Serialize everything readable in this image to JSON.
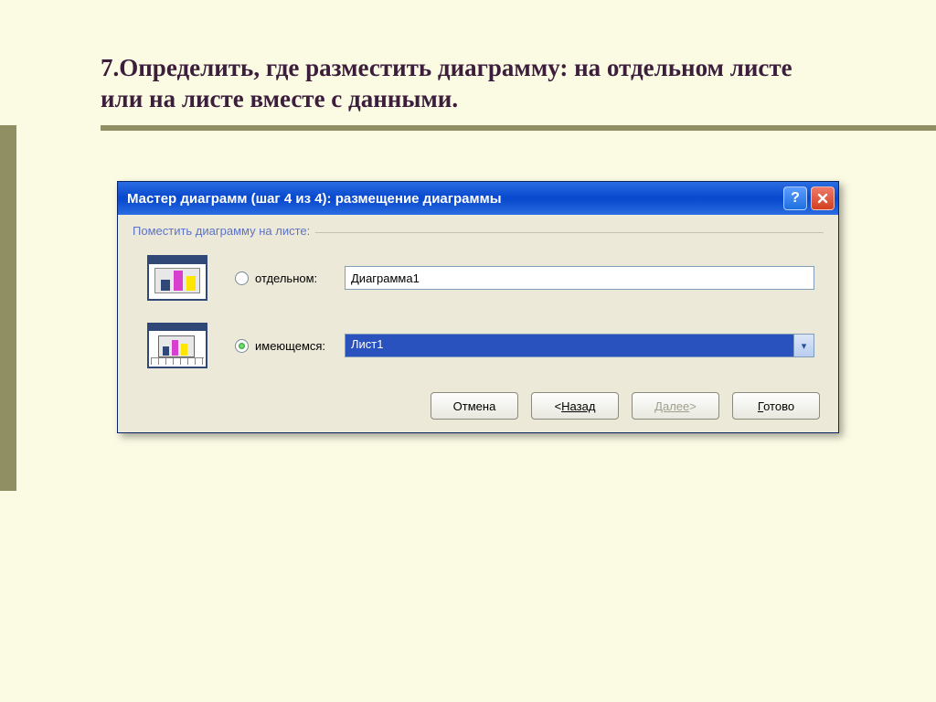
{
  "slide": {
    "heading": "7.Определить, где разместить диаграмму: на отдельном листе или на листе вместе с данными."
  },
  "dialog": {
    "title": "Мастер диаграмм (шаг 4 из 4): размещение диаграммы",
    "group_label": "Поместить диаграмму на листе:",
    "options": [
      {
        "label": "отдельном:",
        "value": "Диаграмма1",
        "selected": false
      },
      {
        "label": "имеющемся:",
        "value": "Лист1",
        "selected": true
      }
    ],
    "buttons": {
      "cancel": "Отмена",
      "back": "Назад",
      "next": "Далее",
      "finish_ul": "Г",
      "finish_rest": "отово"
    }
  }
}
